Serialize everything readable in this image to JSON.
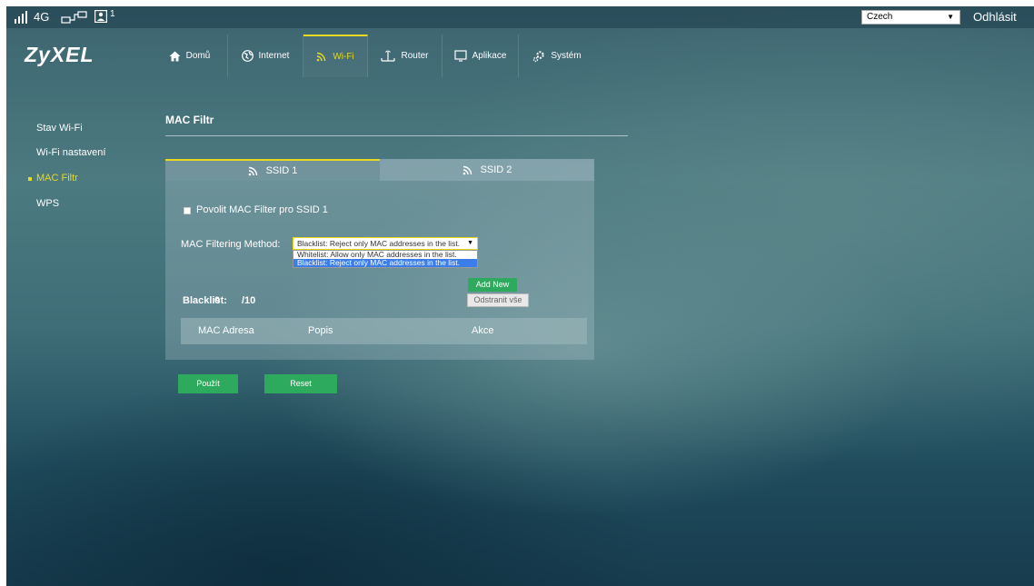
{
  "status_bar": {
    "network_type": "4G",
    "connected_users": "1"
  },
  "header": {
    "language": "Czech",
    "logout": "Odhlásit",
    "logo": "ZyXEL"
  },
  "nav": {
    "items": [
      {
        "label": "Domů",
        "icon": "home-icon"
      },
      {
        "label": "Internet",
        "icon": "globe-icon"
      },
      {
        "label": "Wi-Fi",
        "icon": "wifi-icon",
        "active": true
      },
      {
        "label": "Router",
        "icon": "router-icon"
      },
      {
        "label": "Aplikace",
        "icon": "monitor-icon"
      },
      {
        "label": "Systém",
        "icon": "gear-icon"
      }
    ]
  },
  "sidebar": {
    "items": [
      {
        "label": "Stav Wi-Fi"
      },
      {
        "label": "Wi-Fi nastavení"
      },
      {
        "label": "MAC Filtr",
        "active": true
      },
      {
        "label": "WPS"
      }
    ]
  },
  "main": {
    "title": "MAC Filtr",
    "tabs": [
      {
        "label": "SSID 1",
        "active": true
      },
      {
        "label": "SSID 2"
      }
    ],
    "enable_label": "Povolit MAC Filter pro SSID 1",
    "method_label": "MAC Filtering Method:",
    "method_selected": "Blacklist: Reject only MAC addresses in the list.",
    "method_options": [
      "Whitelist: Allow only MAC addresses in the list.",
      "Blacklist: Reject only MAC addresses in the list."
    ],
    "add_new": "Add New",
    "remove_all": "Odstranit vše",
    "blacklist_label": "Blacklist:",
    "blacklist_count": "0",
    "blacklist_max": "/10",
    "table_headers": [
      "MAC Adresa",
      "Popis",
      "Akce"
    ],
    "apply": "Použít",
    "reset": "Reset"
  },
  "colors": {
    "accent": "#e6d91f",
    "button_green": "#2eaa5e",
    "selected_option": "#3b7de9"
  }
}
